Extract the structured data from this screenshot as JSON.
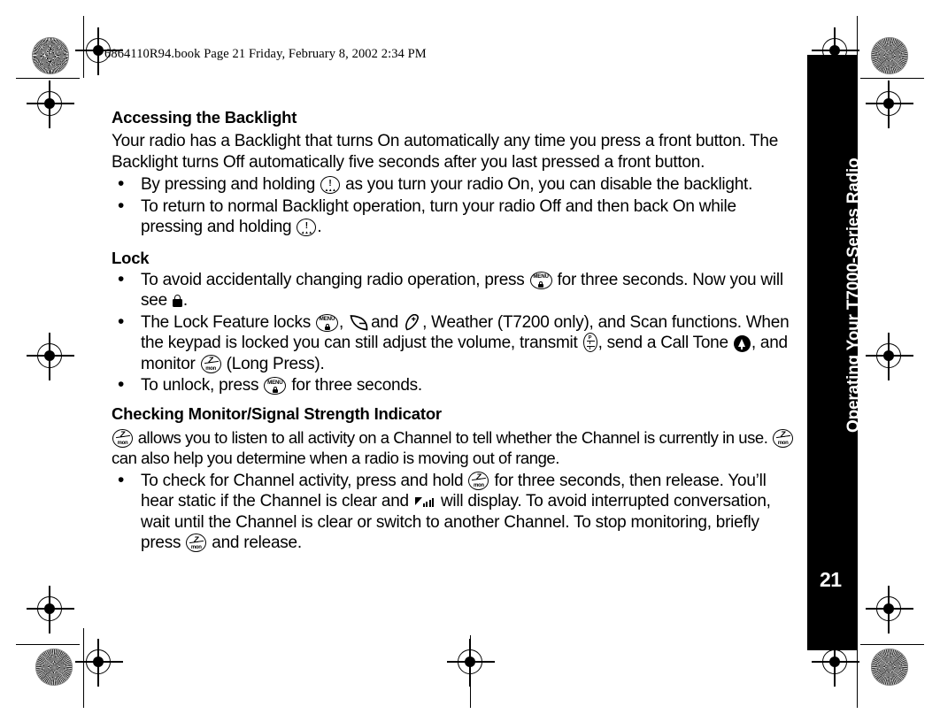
{
  "header": {
    "book_line": "6864110R94.book  Page 21  Friday, February 8, 2002  2:34 PM"
  },
  "sidebar": {
    "chapter_title": "Operating Your T7000-Series Radio",
    "page_number": "21",
    "background_color": "#000000",
    "text_color": "#ffffff"
  },
  "content": {
    "section1": {
      "heading": "Accessing the Backlight",
      "paragraph": "Your radio has a Backlight that turns On automatically any time you press a front button. The Backlight turns Off automatically five seconds after you last pressed a front button.",
      "bullets": [
        {
          "part1": "By pressing and holding",
          "icon": "alert-key-icon",
          "part2": "as you turn your radio On, you can disable the backlight."
        },
        {
          "part1": "To return to normal Backlight operation, turn your radio Off and then back On while pressing and holding",
          "icon": "alert-key-icon",
          "part2": "."
        }
      ]
    },
    "section2": {
      "heading": "Lock",
      "bullets": [
        {
          "part1": "To avoid accidentally changing radio operation, press",
          "icon": "menu-key-icon",
          "part2": "for three seconds. Now you will see",
          "icon2": "padlock-icon",
          "part3": "."
        },
        {
          "part1": "The Lock Feature locks",
          "icon": "menu-key-icon",
          "part2": ",",
          "icon2": "call-alert-icon",
          "part3": "and",
          "icon3": "channel-plus-icon",
          "part4": ", Weather (T7200 only), and Scan functions. When the keypad is locked you can still adjust the volume, transmit",
          "icon4": "ptt-key-icon",
          "part5": ", send a Call Tone",
          "icon5": "call-tone-icon",
          "part6": ", and monitor",
          "icon6": "monitor-key-icon",
          "part7": "(Long Press)."
        },
        {
          "part1": "To unlock, press",
          "icon": "menu-key-icon",
          "part2": "for three seconds."
        }
      ]
    },
    "section3": {
      "heading": "Checking Monitor/Signal Strength Indicator",
      "paragraph_icon1": "monitor-key-icon",
      "paragraph_part1": "allows you to listen to all activity on a Channel to tell whether the Channel is currently in use.",
      "paragraph_icon2": "monitor-key-icon",
      "paragraph_part2": "can also help you determine when a radio is moving out of range.",
      "bullets": [
        {
          "part1": "To check for Channel activity, press and hold",
          "icon": "monitor-key-icon",
          "part2": "for three seconds, then release. You’ll hear static if the Channel is clear and",
          "icon2": "signal-strength-icon",
          "part3": "will display. To avoid interrupted conversation, wait until the Channel is clear or switch to another Channel. To stop monitoring, briefly press",
          "icon3": "monitor-key-icon",
          "part4": "and release."
        }
      ]
    }
  },
  "icon_labels": {
    "alert_top": "!",
    "menu_top": "MENU",
    "monitor_top": "Z",
    "monitor_bottom": "mon",
    "ptt_l1": "P",
    "ptt_l2": "T",
    "ptt_l3": "T"
  },
  "bullet_char": "•"
}
